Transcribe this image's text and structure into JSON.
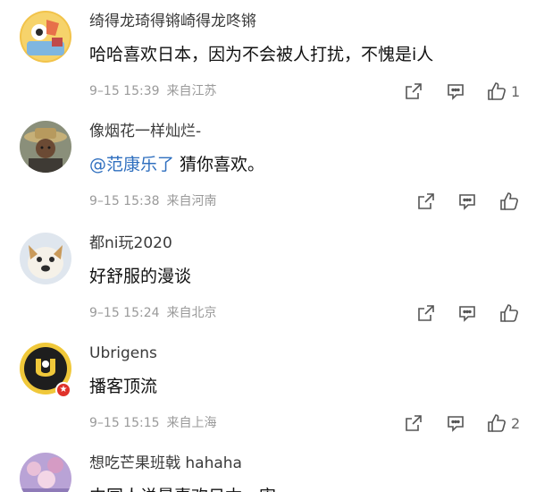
{
  "comments": [
    {
      "username": "绮得龙琦得锵崎得龙咚锵",
      "text": "哈哈喜欢日本，因为不会被人打扰，不愧是i人",
      "time": "9–15 15:39",
      "location": "来自江苏",
      "likes": "1"
    },
    {
      "username": "像烟花一样灿烂-",
      "mention": "@范康乐了",
      "text": " 猜你喜欢。",
      "time": "9–15 15:38",
      "location": "来自河南",
      "likes": ""
    },
    {
      "username": "都ni玩2020",
      "text": "好舒服的漫谈",
      "time": "9–15 15:24",
      "location": "来自北京",
      "likes": ""
    },
    {
      "username": "Ubrigens",
      "text": "播客顶流",
      "time": "9–15 15:15",
      "location": "来自上海",
      "likes": "2"
    },
    {
      "username": "想吃芒果班戟 hahaha",
      "text": "中国人说最喜欢日本，害"
    }
  ],
  "icons": {
    "share": "share-icon",
    "comment": "comment-icon",
    "like": "thumbs-up-icon",
    "badge": "verified-badge-icon"
  },
  "colors": {
    "mention": "#2f6fbf",
    "meta": "#9a9a9a",
    "icon": "#555555",
    "badge": "#e0322a"
  }
}
